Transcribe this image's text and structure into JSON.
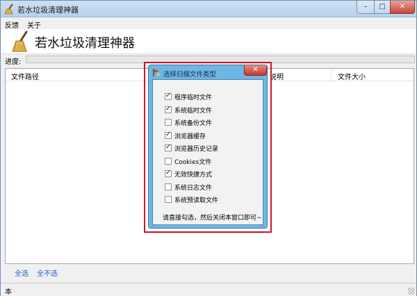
{
  "window": {
    "title": "若水垃圾清理神器",
    "controls": {
      "minimize": "–",
      "maximize": "□",
      "close": "✕"
    }
  },
  "menu": {
    "items": [
      "反馈",
      "关于"
    ]
  },
  "header": {
    "app_title": "若水垃圾清理神器"
  },
  "progress": {
    "label": "进度:",
    "value": 0
  },
  "table": {
    "columns": [
      "文件路径",
      "说明",
      "文件大小"
    ]
  },
  "bottom_links": {
    "select_all": "全选",
    "select_none": "全不选"
  },
  "status": {
    "text": "本"
  },
  "dialog": {
    "title": "选择扫描文件类型",
    "close": "✕",
    "options": [
      {
        "label": "程序临时文件",
        "checked": true
      },
      {
        "label": "系统临时文件",
        "checked": true
      },
      {
        "label": "系统备份文件",
        "checked": false
      },
      {
        "label": "浏览器缓存",
        "checked": true
      },
      {
        "label": "浏览器历史记录",
        "checked": true
      },
      {
        "label": "Cookies文件",
        "checked": false
      },
      {
        "label": "无效快捷方式",
        "checked": true
      },
      {
        "label": "系统日志文件",
        "checked": false
      },
      {
        "label": "系统预读取文件",
        "checked": false
      }
    ],
    "hint": "请直接勾选，然后关闭本窗口即可~"
  },
  "colors": {
    "dialog_frame": "#d0102a",
    "dialog_chrome": "#6eb6e3",
    "link": "#1e5ec9"
  },
  "icons": {
    "app": "broom-icon",
    "dialog": "flag-icon"
  }
}
